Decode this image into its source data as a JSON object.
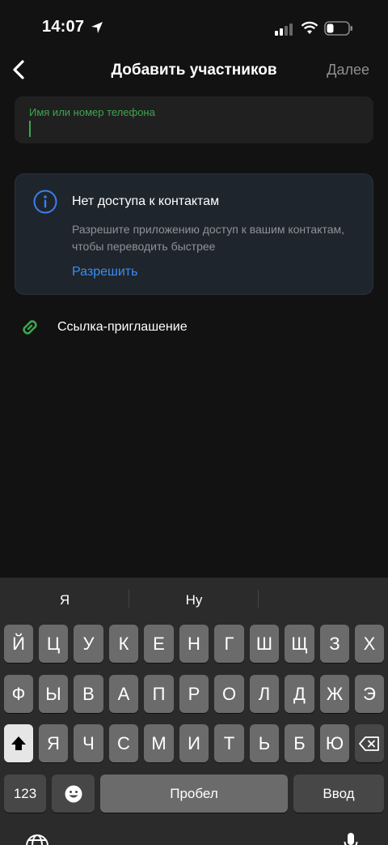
{
  "status": {
    "time": "14:07"
  },
  "nav": {
    "title": "Добавить участников",
    "next": "Далее"
  },
  "search": {
    "placeholder": "Имя или номер телефона"
  },
  "contacts_card": {
    "title": "Нет доступа к контактам",
    "text": "Разрешите приложению доступ к вашим контактам, чтобы переводить быстрее",
    "allow": "Разрешить"
  },
  "invite": {
    "label": "Ссылка-приглашение"
  },
  "keyboard": {
    "suggestions": [
      "Я",
      "Ну",
      ""
    ],
    "row1": [
      "Й",
      "Ц",
      "У",
      "К",
      "Е",
      "Н",
      "Г",
      "Ш",
      "Щ",
      "З",
      "Х"
    ],
    "row2": [
      "Ф",
      "Ы",
      "В",
      "А",
      "П",
      "Р",
      "О",
      "Л",
      "Д",
      "Ж",
      "Э"
    ],
    "row3": [
      "Я",
      "Ч",
      "С",
      "М",
      "И",
      "Т",
      "Ь",
      "Б",
      "Ю"
    ],
    "numbers": "123",
    "space": "Пробел",
    "return": "Ввод"
  },
  "colors": {
    "accent_green": "#3da64f",
    "link_blue": "#3a8ef0",
    "info_blue": "#3a7ff0"
  }
}
